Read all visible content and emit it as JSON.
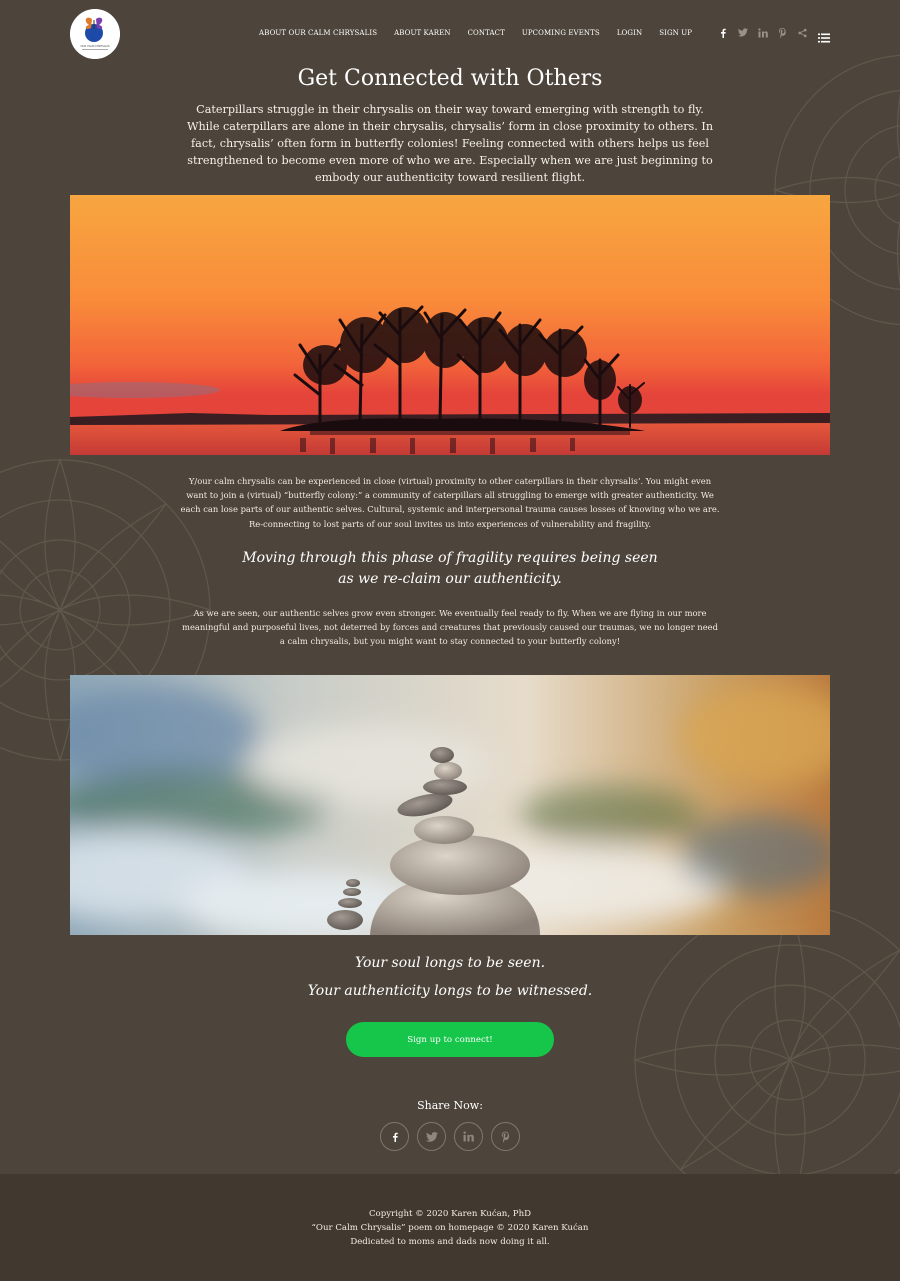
{
  "logo": {
    "text": "OUR CALM CHRYSALIS"
  },
  "nav": {
    "items": [
      "ABOUT OUR CALM CHRYSALIS",
      "ABOUT KAREN",
      "CONTACT",
      "UPCOMING EVENTS",
      "LOGIN",
      "SIGN UP"
    ],
    "social_icons": [
      "facebook-icon",
      "twitter-icon",
      "linkedin-icon",
      "pinterest-icon",
      "share-icon"
    ],
    "menu_icon": "list-menu-icon"
  },
  "main": {
    "title": "Get Connected with Others",
    "intro": "Caterpillars struggle in their chrysalis on their way toward emerging with strength to fly. While caterpillars are alone in their chrysalis, chrysalis’ form in close proximity to others. In fact, chrysalis’ often form in butterfly colonies! Feeling connected with others helps us feel strengthened to become even more of who we are. Especially when we are just beginning to embody our authenticity toward resilient flight.",
    "paragraph1": "Y/our calm chrysalis can be experienced in close (virtual) proximity to other caterpillars in their chyrsalis’. You might even want to join a (virtual) “butterfly colony:” a community of caterpillars all struggling to emerge with greater authenticity. We each can lose parts of our authentic selves. Cultural, systemic and interpersonal trauma causes losses of knowing who we are. Re-connecting to lost parts of our soul invites us into experiences of vulnerability and fragility.",
    "quote_line1": "Moving through this phase of fragility requires being seen",
    "quote_line2": "as we re-claim our authenticity.",
    "paragraph2": "As we are seen, our authentic selves grow even stronger. We eventually feel ready to fly. When we are flying in our more meaningful and purposeful lives, not deterred by forces and creatures that previously caused our traumas, we no longer need a calm chrysalis, but you might want to stay connected to your butterfly colony!",
    "closing_line1": "Your soul longs to be seen.",
    "closing_line2": "Your authenticity longs to be witnessed.",
    "cta_label": "Sign up to connect!"
  },
  "share": {
    "label": "Share Now:",
    "icons": [
      "facebook-icon",
      "twitter-icon",
      "linkedin-icon",
      "pinterest-icon"
    ]
  },
  "footer": {
    "line1": "Copyright © 2020 Karen Kućan, PhD",
    "line2": "“Our Calm Chrysalis” poem on homepage © 2020 Karen Kućan",
    "line3": "Dedicated to moms and dads now doing it all."
  },
  "colors": {
    "background": "#4d453b",
    "footer": "#41392f",
    "cta": "#16c64a"
  }
}
